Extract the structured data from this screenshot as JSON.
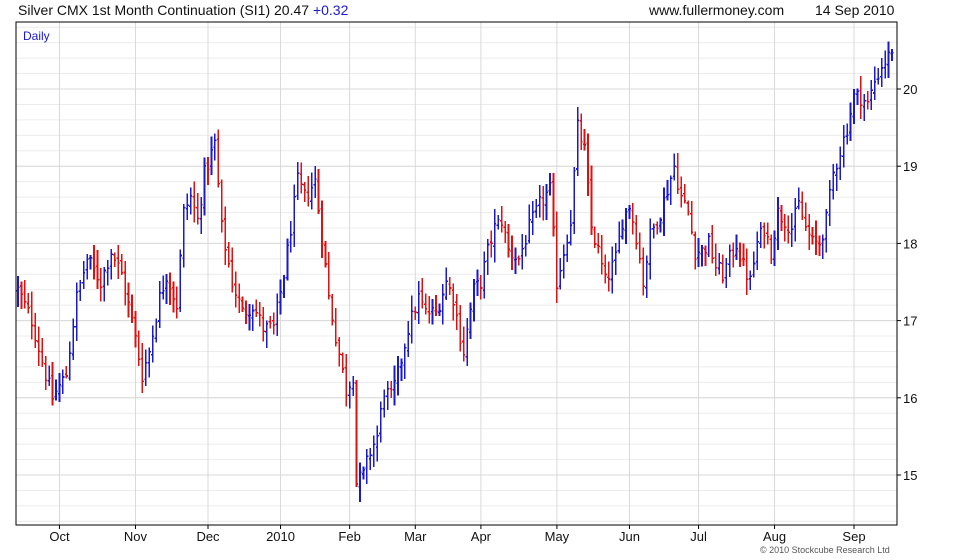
{
  "header": {
    "title": "Silver CMX 1st Month Continuation (SI1)",
    "last": "20.47",
    "change": "+0.32",
    "site": "www.fullermoney.com",
    "date": "14 Sep 2010"
  },
  "copyright": "© 2010 Stockcube Research Ltd",
  "colors": {
    "up": "#1a1acc",
    "down": "#e01010",
    "grid": "#d9d9d9",
    "border": "#000000"
  },
  "chart_data": {
    "type": "line",
    "style": "ohlc-bars",
    "period_label": "Daily",
    "y_axis_side": "right",
    "ylim": [
      14.4,
      20.9
    ],
    "y_ticks": [
      15,
      16,
      17,
      18,
      19,
      20
    ],
    "grid": true,
    "x_ticks": [
      "Oct",
      "Nov",
      "Dec",
      "2010",
      "Feb",
      "Mar",
      "Apr",
      "May",
      "Jun",
      "Jul",
      "Aug",
      "Sep"
    ],
    "x_tick_index": [
      12,
      34,
      55,
      76,
      96,
      115,
      134,
      156,
      177,
      197,
      219,
      242
    ],
    "n_sessions": 254,
    "close_path": [
      [
        0,
        17.4
      ],
      [
        4,
        17.0
      ],
      [
        8,
        16.3
      ],
      [
        10,
        16.0
      ],
      [
        14,
        16.3
      ],
      [
        17,
        17.3
      ],
      [
        20,
        17.8
      ],
      [
        24,
        17.5
      ],
      [
        27,
        17.9
      ],
      [
        30,
        17.6
      ],
      [
        33,
        17.0
      ],
      [
        36,
        16.3
      ],
      [
        38,
        16.6
      ],
      [
        41,
        17.3
      ],
      [
        43,
        17.6
      ],
      [
        46,
        17.2
      ],
      [
        48,
        18.4
      ],
      [
        50,
        18.6
      ],
      [
        52,
        18.3
      ],
      [
        54,
        18.9
      ],
      [
        57,
        19.3
      ],
      [
        59,
        18.2
      ],
      [
        62,
        17.5
      ],
      [
        65,
        17.1
      ],
      [
        68,
        17.2
      ],
      [
        71,
        16.9
      ],
      [
        74,
        16.9
      ],
      [
        77,
        17.6
      ],
      [
        79,
        18.2
      ],
      [
        81,
        18.8
      ],
      [
        83,
        18.6
      ],
      [
        86,
        18.8
      ],
      [
        88,
        18.1
      ],
      [
        90,
        17.3
      ],
      [
        92,
        16.8
      ],
      [
        95,
        16.1
      ],
      [
        97,
        16.3
      ],
      [
        98,
        14.9
      ],
      [
        100,
        15.0
      ],
      [
        102,
        15.3
      ],
      [
        104,
        15.5
      ],
      [
        106,
        16.1
      ],
      [
        108,
        16.0
      ],
      [
        110,
        16.3
      ],
      [
        113,
        16.9
      ],
      [
        116,
        17.3
      ],
      [
        118,
        17.1
      ],
      [
        121,
        17.1
      ],
      [
        124,
        17.5
      ],
      [
        126,
        17.3
      ],
      [
        128,
        16.8
      ],
      [
        129,
        16.6
      ],
      [
        132,
        17.4
      ],
      [
        134,
        17.5
      ],
      [
        136,
        17.9
      ],
      [
        138,
        18.2
      ],
      [
        140,
        18.3
      ],
      [
        142,
        17.9
      ],
      [
        145,
        17.8
      ],
      [
        148,
        18.2
      ],
      [
        151,
        18.5
      ],
      [
        154,
        18.7
      ],
      [
        156,
        17.5
      ],
      [
        158,
        17.9
      ],
      [
        160,
        18.3
      ],
      [
        162,
        19.5
      ],
      [
        164,
        19.2
      ],
      [
        166,
        18.2
      ],
      [
        168,
        17.9
      ],
      [
        170,
        17.5
      ],
      [
        173,
        17.8
      ],
      [
        175,
        18.3
      ],
      [
        177,
        18.5
      ],
      [
        179,
        18.1
      ],
      [
        181,
        17.5
      ],
      [
        183,
        18.1
      ],
      [
        186,
        18.4
      ],
      [
        188,
        18.7
      ],
      [
        190,
        19.0
      ],
      [
        192,
        18.6
      ],
      [
        194,
        18.4
      ],
      [
        196,
        17.9
      ],
      [
        198,
        17.9
      ],
      [
        200,
        18.0
      ],
      [
        202,
        17.7
      ],
      [
        204,
        17.6
      ],
      [
        206,
        17.8
      ],
      [
        208,
        18.0
      ],
      [
        210,
        17.7
      ],
      [
        212,
        17.5
      ],
      [
        214,
        18.0
      ],
      [
        216,
        18.2
      ],
      [
        218,
        17.9
      ],
      [
        220,
        18.4
      ],
      [
        222,
        18.3
      ],
      [
        224,
        18.2
      ],
      [
        226,
        18.5
      ],
      [
        228,
        18.2
      ],
      [
        230,
        18.0
      ],
      [
        232,
        18.0
      ],
      [
        234,
        18.3
      ],
      [
        236,
        18.9
      ],
      [
        238,
        19.2
      ],
      [
        240,
        19.5
      ],
      [
        242,
        19.9
      ],
      [
        244,
        19.9
      ],
      [
        246,
        19.8
      ],
      [
        248,
        20.1
      ],
      [
        250,
        20.3
      ],
      [
        253,
        20.47
      ]
    ]
  }
}
